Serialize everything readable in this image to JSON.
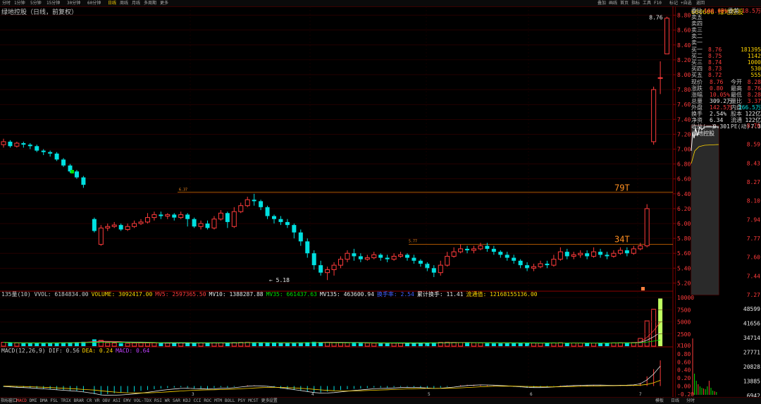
{
  "toolbar": {
    "left_items": [
      "分时",
      "1分钟",
      "5分钟",
      "15分钟",
      "30分钟",
      "60分钟",
      "日线",
      "周线",
      "月线",
      "多周期",
      "更多"
    ],
    "active_index": 6,
    "right_items": [
      "叠加",
      "画线",
      "首页",
      "指标",
      "工具",
      "F10",
      "标记",
      "+自选",
      "返回"
    ]
  },
  "chart_title": "绿地控股（日线，前复权）",
  "price_axis": {
    "labels": [
      "8.80",
      "8.60",
      "8.40",
      "8.20",
      "8.00",
      "7.80",
      "7.60",
      "7.40",
      "7.20",
      "7.00",
      "6.80",
      "6.60",
      "6.40",
      "6.20",
      "6.00",
      "5.80",
      "5.60",
      "5.40",
      "5.20"
    ],
    "high_label": "8.76",
    "low_label": "5.18",
    "level_labels": [
      "79T",
      "34T"
    ],
    "small_marks": [
      "6.37",
      "5.77"
    ]
  },
  "volume_pane": {
    "header": [
      {
        "text": "135量(10) VVOL: 6184834.00",
        "color": "#c8c8c8"
      },
      {
        "text": "VOLUME: 3092417.00",
        "color": "#ffd400"
      },
      {
        "text": "MV5: 2597365.50",
        "color": "#ff3b3b"
      },
      {
        "text": "MV10: 1388287.88",
        "color": "#e8e8e8"
      },
      {
        "text": "MV35: 661437.63",
        "color": "#00e000"
      },
      {
        "text": "MV135: 463600.94",
        "color": "#e8e8e8"
      },
      {
        "text": "换手率: 2.54",
        "color": "#4060ff"
      },
      {
        "text": "累计换手: 11.41",
        "color": "#e8e8e8"
      },
      {
        "text": "流通值: 12168155136.00",
        "color": "#ffd400"
      }
    ],
    "axis_labels": [
      "10000",
      "7500",
      "5000",
      "2500",
      "X100"
    ]
  },
  "macd_pane": {
    "header": [
      {
        "text": "MACD(12,26,9) DIF: 0.56",
        "color": "#c8c8c8"
      },
      {
        "text": "DEA: 0.24",
        "color": "#ffd400"
      },
      {
        "text": "MACD: 0.64",
        "color": "#c040ff"
      }
    ],
    "axis_labels": [
      "0.80",
      "0.60",
      "0.40",
      "0.20",
      "0.00",
      "-0.20"
    ]
  },
  "right_panel": {
    "code": "600606",
    "name": "绿地控股",
    "ratio_label": "委比",
    "ratio_value": "100.00%",
    "diff_label": "委差",
    "diff_value": "18.5万",
    "asks": [
      "卖五",
      "卖四",
      "卖三",
      "卖二",
      "卖一"
    ],
    "bids": [
      {
        "label": "买一",
        "price": "8.76",
        "vol": "181395"
      },
      {
        "label": "买二",
        "price": "8.75",
        "vol": "1142"
      },
      {
        "label": "买三",
        "price": "8.74",
        "vol": "1000"
      },
      {
        "label": "买四",
        "price": "8.73",
        "vol": "530"
      },
      {
        "label": "买五",
        "price": "8.72",
        "vol": "555"
      }
    ],
    "stats": [
      {
        "l1": "现价",
        "v1": "8.76",
        "c1": "red",
        "l2": "今开",
        "v2": "8.28",
        "c2": "red"
      },
      {
        "l1": "涨跌",
        "v1": "0.80",
        "c1": "red",
        "l2": "最高",
        "v2": "8.76",
        "c2": "red"
      },
      {
        "l1": "涨幅",
        "v1": "10.05%",
        "c1": "red",
        "l2": "最低",
        "v2": "8.28",
        "c2": "red"
      },
      {
        "l1": "总量",
        "v1": "309.2万",
        "c1": "wht",
        "l2": "量比",
        "v2": "3.37",
        "c2": "red"
      },
      {
        "l1": "外盘",
        "v1": "142.5万",
        "c1": "red",
        "l2": "内盘",
        "v2": "166.5万",
        "c2": "grn"
      },
      {
        "l1": "换手",
        "v1": "2.54%",
        "c1": "wht",
        "l2": "股本",
        "v2": "122亿",
        "c2": "wht"
      },
      {
        "l1": "净资",
        "v1": "6.34",
        "c1": "wht",
        "l2": "流通",
        "v2": "122亿",
        "c2": "wht"
      },
      {
        "l1": "收益(一)",
        "v1": "-0.301",
        "c1": "wht",
        "l2": "PE(动)",
        "v2": "7.3",
        "c2": "wht"
      }
    ],
    "mini_title": "绿地控股",
    "mini_axis": [
      "8.76",
      "8.59",
      "8.43",
      "8.27",
      "8.10",
      "7.94",
      "7.77",
      "7.60",
      "7.44",
      "7.27"
    ],
    "mini_vol_axis": [
      "48599",
      "41656",
      "34714",
      "27771",
      "20828",
      "13885",
      "6942"
    ]
  },
  "x_axis": {
    "labels": [
      "3",
      "4",
      "5",
      "6",
      "7"
    ]
  },
  "bottom_tabs": {
    "items": [
      "指标",
      "窗口",
      "MACD",
      "DMI",
      "DMA",
      "FSL",
      "TRIX",
      "BRAR",
      "CR",
      "VR",
      "OBV",
      "ASI",
      "EMV",
      "VOL-TDX",
      "RSI",
      "WR",
      "SAR",
      "KDJ",
      "CCI",
      "ROC",
      "MTM",
      "BOLL",
      "PSY",
      "MCST",
      "更多",
      "设置"
    ],
    "active_index": 2,
    "right_items": [
      "模板",
      "日线",
      "分时"
    ]
  },
  "chart_data": {
    "type": "candlestick",
    "title": "绿地控股（日线，前复权）",
    "ylim": [
      5.1,
      8.9
    ],
    "candles": [
      [
        7.06,
        7.1,
        7.14,
        7.02
      ],
      [
        7.1,
        7.04,
        7.12,
        7.02
      ],
      [
        7.04,
        7.08,
        7.1,
        7.02
      ],
      [
        7.08,
        7.06,
        7.1,
        7.02
      ],
      [
        7.06,
        7.04,
        7.08,
        7.0
      ],
      [
        7.04,
        6.98,
        7.06,
        6.96
      ],
      [
        6.98,
        6.96,
        7.0,
        6.92
      ],
      [
        6.96,
        6.94,
        6.98,
        6.9
      ],
      [
        6.94,
        6.86,
        6.96,
        6.84
      ],
      [
        6.86,
        6.78,
        6.88,
        6.76
      ],
      [
        6.78,
        6.7,
        6.8,
        6.68
      ],
      [
        6.7,
        6.62,
        6.72,
        6.6
      ],
      [
        6.62,
        6.52,
        6.64,
        6.48
      ],
      [
        6.06,
        5.9,
        6.08,
        5.88
      ],
      [
        5.72,
        5.94,
        5.98,
        5.7
      ],
      [
        5.94,
        5.96,
        6.0,
        5.9
      ],
      [
        5.96,
        5.98,
        6.02,
        5.94
      ],
      [
        5.98,
        5.92,
        6.0,
        5.9
      ],
      [
        5.92,
        5.96,
        6.0,
        5.9
      ],
      [
        5.96,
        6.0,
        6.04,
        5.94
      ],
      [
        6.0,
        6.02,
        6.06,
        5.98
      ],
      [
        6.02,
        6.08,
        6.14,
        6.0
      ],
      [
        6.08,
        6.12,
        6.16,
        6.04
      ],
      [
        6.12,
        6.1,
        6.16,
        6.06
      ],
      [
        6.1,
        6.12,
        6.14,
        6.06
      ],
      [
        6.12,
        6.08,
        6.14,
        6.04
      ],
      [
        6.08,
        6.12,
        6.16,
        6.06
      ],
      [
        6.12,
        6.06,
        6.14,
        5.96
      ],
      [
        6.06,
        5.96,
        6.08,
        5.94
      ],
      [
        5.96,
        6.0,
        6.04,
        5.92
      ],
      [
        6.0,
        5.94,
        6.04,
        5.92
      ],
      [
        5.94,
        6.06,
        6.1,
        5.92
      ],
      [
        6.06,
        6.14,
        6.18,
        6.04
      ],
      [
        6.14,
        6.02,
        6.16,
        5.94
      ],
      [
        5.96,
        6.16,
        6.22,
        5.94
      ],
      [
        6.16,
        6.24,
        6.28,
        6.14
      ],
      [
        6.24,
        6.32,
        6.36,
        6.22
      ],
      [
        6.32,
        6.3,
        6.4,
        6.24
      ],
      [
        6.3,
        6.22,
        6.32,
        6.18
      ],
      [
        6.22,
        6.1,
        6.24,
        6.06
      ],
      [
        6.1,
        6.06,
        6.12,
        6.0
      ],
      [
        6.06,
        6.02,
        6.1,
        5.98
      ],
      [
        6.02,
        5.98,
        6.06,
        5.94
      ],
      [
        5.98,
        5.88,
        6.0,
        5.8
      ],
      [
        5.88,
        5.76,
        5.92,
        5.7
      ],
      [
        5.76,
        5.6,
        5.8,
        5.54
      ],
      [
        5.6,
        5.44,
        5.64,
        5.38
      ],
      [
        5.44,
        5.34,
        5.5,
        5.3
      ],
      [
        5.34,
        5.38,
        5.42,
        5.24
      ],
      [
        5.38,
        5.44,
        5.48,
        5.3
      ],
      [
        5.44,
        5.52,
        5.56,
        5.4
      ],
      [
        5.52,
        5.6,
        5.64,
        5.48
      ],
      [
        5.6,
        5.56,
        5.66,
        5.5
      ],
      [
        5.56,
        5.52,
        5.6,
        5.48
      ],
      [
        5.52,
        5.54,
        5.58,
        5.5
      ],
      [
        5.54,
        5.58,
        5.62,
        5.52
      ],
      [
        5.58,
        5.54,
        5.6,
        5.5
      ],
      [
        5.54,
        5.52,
        5.58,
        5.48
      ],
      [
        5.52,
        5.56,
        5.6,
        5.5
      ],
      [
        5.56,
        5.58,
        5.62,
        5.54
      ],
      [
        5.58,
        5.54,
        5.6,
        5.5
      ],
      [
        5.54,
        5.5,
        5.58,
        5.46
      ],
      [
        5.5,
        5.46,
        5.52,
        5.42
      ],
      [
        5.46,
        5.4,
        5.48,
        5.36
      ],
      [
        5.4,
        5.34,
        5.44,
        5.28
      ],
      [
        5.34,
        5.44,
        5.5,
        5.3
      ],
      [
        5.44,
        5.56,
        5.62,
        5.42
      ],
      [
        5.56,
        5.62,
        5.68,
        5.54
      ],
      [
        5.62,
        5.66,
        5.72,
        5.6
      ],
      [
        5.66,
        5.64,
        5.7,
        5.6
      ],
      [
        5.64,
        5.66,
        5.7,
        5.6
      ],
      [
        5.66,
        5.7,
        5.74,
        5.64
      ],
      [
        5.7,
        5.66,
        5.74,
        5.62
      ],
      [
        5.66,
        5.62,
        5.7,
        5.58
      ],
      [
        5.62,
        5.58,
        5.64,
        5.54
      ],
      [
        5.58,
        5.54,
        5.62,
        5.5
      ],
      [
        5.54,
        5.5,
        5.58,
        5.46
      ],
      [
        5.5,
        5.44,
        5.52,
        5.4
      ],
      [
        5.44,
        5.4,
        5.48,
        5.36
      ],
      [
        5.4,
        5.42,
        5.46,
        5.36
      ],
      [
        5.42,
        5.46,
        5.5,
        5.4
      ],
      [
        5.46,
        5.44,
        5.5,
        5.4
      ],
      [
        5.44,
        5.52,
        5.58,
        5.42
      ],
      [
        5.52,
        5.62,
        5.68,
        5.5
      ],
      [
        5.62,
        5.56,
        5.66,
        5.52
      ],
      [
        5.56,
        5.58,
        5.62,
        5.52
      ],
      [
        5.58,
        5.6,
        5.64,
        5.54
      ],
      [
        5.6,
        5.56,
        5.64,
        5.52
      ],
      [
        5.56,
        5.62,
        5.68,
        5.54
      ],
      [
        5.62,
        5.58,
        5.66,
        5.54
      ],
      [
        5.58,
        5.56,
        5.62,
        5.52
      ],
      [
        5.56,
        5.6,
        5.64,
        5.54
      ],
      [
        5.6,
        5.64,
        5.68,
        5.58
      ],
      [
        5.64,
        5.6,
        5.68,
        5.56
      ],
      [
        5.6,
        5.66,
        5.7,
        5.58
      ],
      [
        5.66,
        5.7,
        5.74,
        5.64
      ],
      [
        5.7,
        6.2,
        6.26,
        5.68
      ],
      [
        7.1,
        7.8,
        7.84,
        7.06
      ],
      [
        7.96,
        7.96,
        8.18,
        7.74
      ],
      [
        8.28,
        8.76,
        8.78,
        8.28
      ]
    ],
    "volume_x100": [
      800,
      700,
      650,
      600,
      620,
      700,
      680,
      650,
      720,
      760,
      800,
      820,
      900,
      1400,
      1200,
      700,
      650,
      620,
      600,
      640,
      660,
      700,
      680,
      650,
      620,
      640,
      660,
      700,
      680,
      650,
      640,
      700,
      720,
      680,
      760,
      800,
      820,
      760,
      700,
      680,
      660,
      640,
      620,
      700,
      760,
      820,
      900,
      860,
      780,
      720,
      700,
      680,
      660,
      640,
      620,
      600,
      620,
      640,
      620,
      600,
      620,
      640,
      660,
      700,
      760,
      800,
      820,
      780,
      720,
      700,
      680,
      660,
      640,
      620,
      640,
      660,
      680,
      700,
      660,
      640,
      620,
      640,
      680,
      720,
      700,
      660,
      640,
      620,
      640,
      660,
      680,
      700,
      720,
      740,
      760,
      1600,
      5200,
      7600,
      9800
    ],
    "macd": [
      -0.02,
      -0.03,
      -0.04,
      -0.04,
      -0.05,
      -0.06,
      -0.07,
      -0.08,
      -0.09,
      -0.1,
      -0.11,
      -0.12,
      -0.14,
      -0.2,
      -0.22,
      -0.2,
      -0.18,
      -0.17,
      -0.16,
      -0.14,
      -0.12,
      -0.1,
      -0.08,
      -0.06,
      -0.05,
      -0.04,
      -0.03,
      -0.04,
      -0.06,
      -0.06,
      -0.07,
      -0.05,
      -0.03,
      -0.04,
      -0.02,
      0.0,
      0.02,
      0.02,
      0.0,
      -0.02,
      -0.04,
      -0.06,
      -0.08,
      -0.1,
      -0.12,
      -0.14,
      -0.16,
      -0.16,
      -0.14,
      -0.12,
      -0.1,
      -0.08,
      -0.07,
      -0.06,
      -0.05,
      -0.04,
      -0.04,
      -0.04,
      -0.03,
      -0.02,
      -0.02,
      -0.03,
      -0.04,
      -0.05,
      -0.06,
      -0.04,
      -0.02,
      0.0,
      0.02,
      0.03,
      0.03,
      0.03,
      0.02,
      0.01,
      0.0,
      -0.01,
      -0.02,
      -0.03,
      -0.04,
      -0.04,
      -0.03,
      -0.02,
      -0.01,
      0.01,
      0.02,
      0.02,
      0.02,
      0.02,
      0.02,
      0.02,
      0.01,
      0.01,
      0.02,
      0.02,
      0.03,
      0.08,
      0.24,
      0.42,
      0.64
    ]
  }
}
